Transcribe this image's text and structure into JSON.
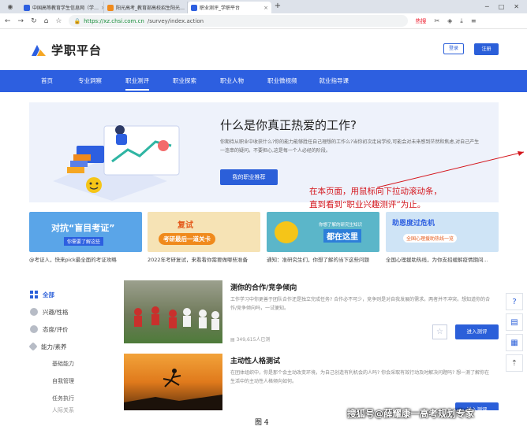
{
  "browser": {
    "tabs": [
      {
        "title": "中国高等教育学生信息网（学…",
        "color": "#2d5fe0"
      },
      {
        "title": "阳光高考_教育部高校招生阳光…",
        "color": "#f08a1c"
      },
      {
        "title": "职业测评_学职平台",
        "color": "#2d5fe0"
      }
    ],
    "new_tab": "+",
    "url_lock": "🔒",
    "url_host": "https://xz.chsi.com.cn",
    "url_path": "/survey/index.action",
    "hot_label": "热搜"
  },
  "header": {
    "logo_text": "学职平台",
    "login": "登录",
    "register": "注册"
  },
  "nav": {
    "items": [
      "首页",
      "专业洞察",
      "职业测评",
      "职业探索",
      "职业人物",
      "职业微视频",
      "就业指导课"
    ],
    "active_index": 2
  },
  "hero": {
    "title": "什么是你真正热爱的工作?",
    "desc": "你期待从职业中收获什么?你的能力能够胜任自己理想的工作么?当你初次走出学校,可能会对未来感到茫然和焦虑,对自己产生一连串的疑问。不要担心,这是每一个人必经的阶段。",
    "cta": "我的职业推荐"
  },
  "annotation": {
    "line1": "在本页面，用鼠标向下拉动滚动条，",
    "line2": "直到看到“职业兴趣测评”为止。"
  },
  "cards": [
    {
      "title": "对抗“盲目考证”",
      "sub": "你需要了解这些",
      "caption": "@考证人，快来pick最全面的考证攻略"
    },
    {
      "title": "复试",
      "sub": "考研最后一道关卡",
      "caption": "2022年考研复试，来看看你需要做哪些准备"
    },
    {
      "title": "都在这里",
      "sub": "你想了解的研究生知识",
      "caption": "通知：准研究生们，你想了解的当下这些问题"
    },
    {
      "title": "助恩度过危机",
      "sub": "全国心理援助热线一览",
      "caption": "全国心理援助热线，为你支招缓解疫情期间..."
    }
  ],
  "sidebar": {
    "categories": [
      {
        "label": "全部",
        "icon": "grid-icon"
      },
      {
        "label": "兴趣/性格",
        "icon": "smile-icon"
      },
      {
        "label": "态度/评价",
        "icon": "clock-icon"
      },
      {
        "label": "能力/素养",
        "icon": "heart-icon"
      }
    ],
    "subitems": [
      "基础能力",
      "自我管理",
      "任务执行",
      "人际关系"
    ]
  },
  "tests": [
    {
      "title": "测你的合作/竞争倾向",
      "desc": "工作学习中你更善于团队合作还是独立完成任务? 合作必不可少，竞争则是对自我发展的需求。两者并不冲突。想知道你的合作/竞争倾向吗，一试便知。",
      "count": "349,615人已测",
      "enter": "进入测评"
    },
    {
      "title": "主动性人格测试",
      "desc": "在团体组织中，你是那个会主动改变环境，为自己创造有利机会的人吗? 你会采取有效行动及时解决问题吗? 想一测了解你在生活中的主动性人格倾向如何。",
      "count": "",
      "enter": "进入测评"
    }
  ],
  "figure_caption": "图 4",
  "watermark": "搜狐号@薛耀康一高考规划专家"
}
